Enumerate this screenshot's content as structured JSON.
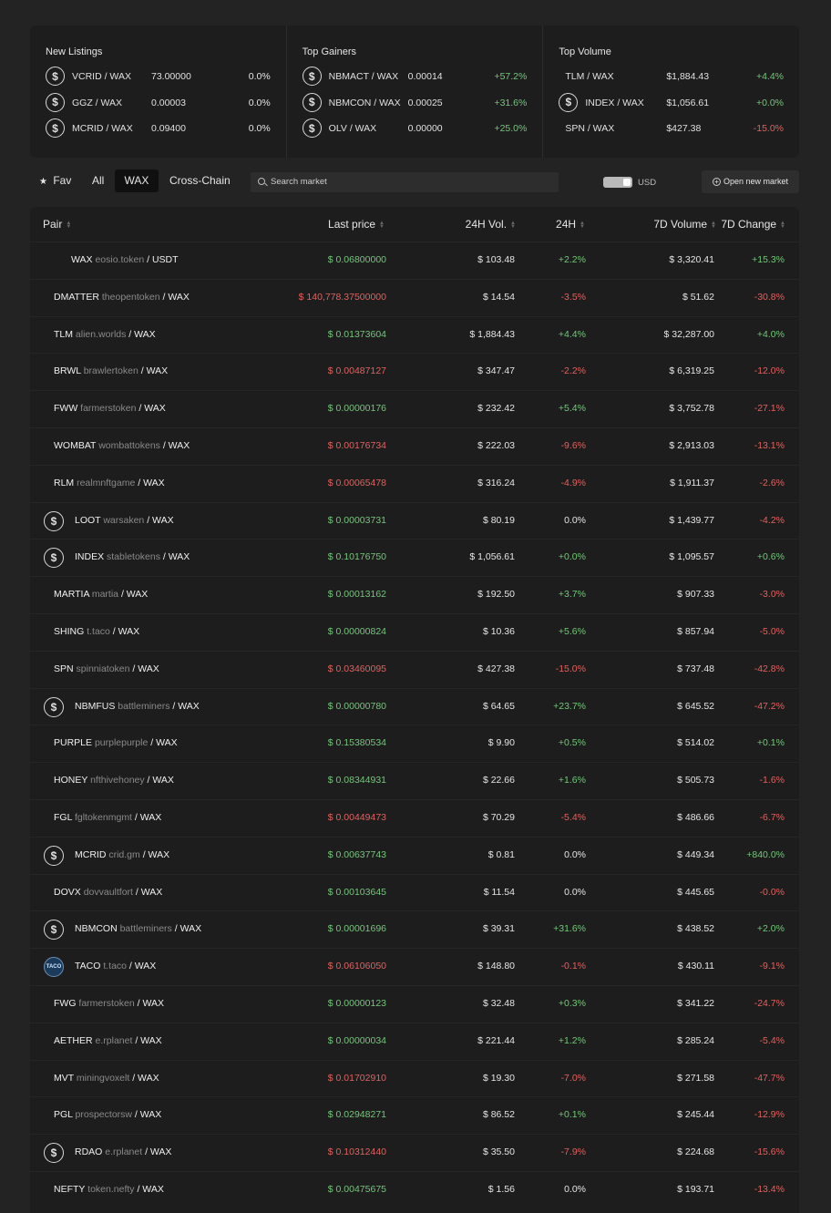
{
  "summary": {
    "new_listings": {
      "title": "New Listings",
      "rows": [
        {
          "icon": "dollar-coin-icon",
          "pair": "VCRID / WAX",
          "value": "73.00000",
          "change": "0.0%",
          "dir": "neu"
        },
        {
          "icon": "dollar-coin-icon",
          "pair": "GGZ / WAX",
          "value": "0.00003",
          "change": "0.0%",
          "dir": "neu"
        },
        {
          "icon": "dollar-coin-icon",
          "pair": "MCRID / WAX",
          "value": "0.09400",
          "change": "0.0%",
          "dir": "neu"
        }
      ]
    },
    "top_gainers": {
      "title": "Top Gainers",
      "rows": [
        {
          "icon": "dollar-coin-icon",
          "pair": "NBMACT / WAX",
          "value": "0.00014",
          "change": "+57.2%",
          "dir": "pos"
        },
        {
          "icon": "dollar-coin-icon",
          "pair": "NBMCON / WAX",
          "value": "0.00025",
          "change": "+31.6%",
          "dir": "pos"
        },
        {
          "icon": "dollar-coin-icon",
          "pair": "OLV / WAX",
          "value": "0.00000",
          "change": "+25.0%",
          "dir": "pos"
        }
      ]
    },
    "top_volume": {
      "title": "Top Volume",
      "rows": [
        {
          "icon": "",
          "pair": "TLM / WAX",
          "value": "$1,884.43",
          "change": "+4.4%",
          "dir": "pos"
        },
        {
          "icon": "dollar-coin-icon",
          "pair": "INDEX / WAX",
          "value": "$1,056.61",
          "change": "+0.0%",
          "dir": "pos"
        },
        {
          "icon": "",
          "pair": "SPN / WAX",
          "value": "$427.38",
          "change": "-15.0%",
          "dir": "neg"
        }
      ]
    }
  },
  "toolbar": {
    "fav_label": "Fav",
    "all_label": "All",
    "wax_label": "WAX",
    "cross_chain_label": "Cross-Chain",
    "search_placeholder": "Search market",
    "currency_label": "USD",
    "open_market_label": "Open new market"
  },
  "table": {
    "headers": {
      "pair": "Pair",
      "last_price": "Last price",
      "vol_24h": "24H Vol.",
      "change_24h": "24H",
      "vol_7d": "7D Volume",
      "change_7d": "7D Change"
    },
    "rows": [
      {
        "icon": "",
        "symbol": "WAX",
        "contract": "eosio.token",
        "quote": "USDT",
        "price": "$ 0.06800000",
        "price_dir": "pos",
        "vol24": "$ 103.48",
        "ch24": "+2.2%",
        "ch24_dir": "pos",
        "vol7": "$ 3,320.41",
        "ch7": "+15.3%",
        "ch7_dir": "pos"
      },
      {
        "icon": "",
        "symbol": "DMATTER",
        "contract": "theopentoken",
        "quote": "WAX",
        "price": "$ 140,778.37500000",
        "price_dir": "neg",
        "vol24": "$ 14.54",
        "ch24": "-3.5%",
        "ch24_dir": "neg",
        "vol7": "$ 51.62",
        "ch7": "-30.8%",
        "ch7_dir": "neg"
      },
      {
        "icon": "",
        "symbol": "TLM",
        "contract": "alien.worlds",
        "quote": "WAX",
        "price": "$ 0.01373604",
        "price_dir": "pos",
        "vol24": "$ 1,884.43",
        "ch24": "+4.4%",
        "ch24_dir": "pos",
        "vol7": "$ 32,287.00",
        "ch7": "+4.0%",
        "ch7_dir": "pos"
      },
      {
        "icon": "",
        "symbol": "BRWL",
        "contract": "brawlertoken",
        "quote": "WAX",
        "price": "$ 0.00487127",
        "price_dir": "neg",
        "vol24": "$ 347.47",
        "ch24": "-2.2%",
        "ch24_dir": "neg",
        "vol7": "$ 6,319.25",
        "ch7": "-12.0%",
        "ch7_dir": "neg"
      },
      {
        "icon": "",
        "symbol": "FWW",
        "contract": "farmerstoken",
        "quote": "WAX",
        "price": "$ 0.00000176",
        "price_dir": "pos",
        "vol24": "$ 232.42",
        "ch24": "+5.4%",
        "ch24_dir": "pos",
        "vol7": "$ 3,752.78",
        "ch7": "-27.1%",
        "ch7_dir": "neg"
      },
      {
        "icon": "",
        "symbol": "WOMBAT",
        "contract": "wombattokens",
        "quote": "WAX",
        "price": "$ 0.00176734",
        "price_dir": "neg",
        "vol24": "$ 222.03",
        "ch24": "-9.6%",
        "ch24_dir": "neg",
        "vol7": "$ 2,913.03",
        "ch7": "-13.1%",
        "ch7_dir": "neg"
      },
      {
        "icon": "",
        "symbol": "RLM",
        "contract": "realmnftgame",
        "quote": "WAX",
        "price": "$ 0.00065478",
        "price_dir": "neg",
        "vol24": "$ 316.24",
        "ch24": "-4.9%",
        "ch24_dir": "neg",
        "vol7": "$ 1,911.37",
        "ch7": "-2.6%",
        "ch7_dir": "neg"
      },
      {
        "icon": "dollar-coin-icon",
        "symbol": "LOOT",
        "contract": "warsaken",
        "quote": "WAX",
        "price": "$ 0.00003731",
        "price_dir": "pos",
        "vol24": "$ 80.19",
        "ch24": "0.0%",
        "ch24_dir": "neu",
        "vol7": "$ 1,439.77",
        "ch7": "-4.2%",
        "ch7_dir": "neg"
      },
      {
        "icon": "dollar-coin-icon",
        "symbol": "INDEX",
        "contract": "stabletokens",
        "quote": "WAX",
        "price": "$ 0.10176750",
        "price_dir": "pos",
        "vol24": "$ 1,056.61",
        "ch24": "+0.0%",
        "ch24_dir": "pos",
        "vol7": "$ 1,095.57",
        "ch7": "+0.6%",
        "ch7_dir": "pos"
      },
      {
        "icon": "",
        "symbol": "MARTIA",
        "contract": "martia",
        "quote": "WAX",
        "price": "$ 0.00013162",
        "price_dir": "pos",
        "vol24": "$ 192.50",
        "ch24": "+3.7%",
        "ch24_dir": "pos",
        "vol7": "$ 907.33",
        "ch7": "-3.0%",
        "ch7_dir": "neg"
      },
      {
        "icon": "",
        "symbol": "SHING",
        "contract": "t.taco",
        "quote": "WAX",
        "price": "$ 0.00000824",
        "price_dir": "pos",
        "vol24": "$ 10.36",
        "ch24": "+5.6%",
        "ch24_dir": "pos",
        "vol7": "$ 857.94",
        "ch7": "-5.0%",
        "ch7_dir": "neg"
      },
      {
        "icon": "",
        "symbol": "SPN",
        "contract": "spinniatoken",
        "quote": "WAX",
        "price": "$ 0.03460095",
        "price_dir": "neg",
        "vol24": "$ 427.38",
        "ch24": "-15.0%",
        "ch24_dir": "neg",
        "vol7": "$ 737.48",
        "ch7": "-42.8%",
        "ch7_dir": "neg"
      },
      {
        "icon": "dollar-coin-icon",
        "symbol": "NBMFUS",
        "contract": "battleminers",
        "quote": "WAX",
        "price": "$ 0.00000780",
        "price_dir": "pos",
        "vol24": "$ 64.65",
        "ch24": "+23.7%",
        "ch24_dir": "pos",
        "vol7": "$ 645.52",
        "ch7": "-47.2%",
        "ch7_dir": "neg"
      },
      {
        "icon": "",
        "symbol": "PURPLE",
        "contract": "purplepurple",
        "quote": "WAX",
        "price": "$ 0.15380534",
        "price_dir": "pos",
        "vol24": "$ 9.90",
        "ch24": "+0.5%",
        "ch24_dir": "pos",
        "vol7": "$ 514.02",
        "ch7": "+0.1%",
        "ch7_dir": "pos"
      },
      {
        "icon": "",
        "symbol": "HONEY",
        "contract": "nfthivehoney",
        "quote": "WAX",
        "price": "$ 0.08344931",
        "price_dir": "pos",
        "vol24": "$ 22.66",
        "ch24": "+1.6%",
        "ch24_dir": "pos",
        "vol7": "$ 505.73",
        "ch7": "-1.6%",
        "ch7_dir": "neg"
      },
      {
        "icon": "",
        "symbol": "FGL",
        "contract": "fgltokenmgmt",
        "quote": "WAX",
        "price": "$ 0.00449473",
        "price_dir": "neg",
        "vol24": "$ 70.29",
        "ch24": "-5.4%",
        "ch24_dir": "neg",
        "vol7": "$ 486.66",
        "ch7": "-6.7%",
        "ch7_dir": "neg"
      },
      {
        "icon": "dollar-coin-icon",
        "symbol": "MCRID",
        "contract": "crid.gm",
        "quote": "WAX",
        "price": "$ 0.00637743",
        "price_dir": "pos",
        "vol24": "$ 0.81",
        "ch24": "0.0%",
        "ch24_dir": "neu",
        "vol7": "$ 449.34",
        "ch7": "+840.0%",
        "ch7_dir": "pos"
      },
      {
        "icon": "",
        "symbol": "DOVX",
        "contract": "dovvaultfort",
        "quote": "WAX",
        "price": "$ 0.00103645",
        "price_dir": "pos",
        "vol24": "$ 11.54",
        "ch24": "0.0%",
        "ch24_dir": "neu",
        "vol7": "$ 445.65",
        "ch7": "-0.0%",
        "ch7_dir": "neg"
      },
      {
        "icon": "dollar-coin-icon",
        "symbol": "NBMCON",
        "contract": "battleminers",
        "quote": "WAX",
        "price": "$ 0.00001696",
        "price_dir": "pos",
        "vol24": "$ 39.31",
        "ch24": "+31.6%",
        "ch24_dir": "pos",
        "vol7": "$ 438.52",
        "ch7": "+2.0%",
        "ch7_dir": "pos"
      },
      {
        "icon": "taco-logo-icon",
        "symbol": "TACO",
        "contract": "t.taco",
        "quote": "WAX",
        "price": "$ 0.06106050",
        "price_dir": "neg",
        "vol24": "$ 148.80",
        "ch24": "-0.1%",
        "ch24_dir": "neg",
        "vol7": "$ 430.11",
        "ch7": "-9.1%",
        "ch7_dir": "neg"
      },
      {
        "icon": "",
        "symbol": "FWG",
        "contract": "farmerstoken",
        "quote": "WAX",
        "price": "$ 0.00000123",
        "price_dir": "pos",
        "vol24": "$ 32.48",
        "ch24": "+0.3%",
        "ch24_dir": "pos",
        "vol7": "$ 341.22",
        "ch7": "-24.7%",
        "ch7_dir": "neg"
      },
      {
        "icon": "",
        "symbol": "AETHER",
        "contract": "e.rplanet",
        "quote": "WAX",
        "price": "$ 0.00000034",
        "price_dir": "pos",
        "vol24": "$ 221.44",
        "ch24": "+1.2%",
        "ch24_dir": "pos",
        "vol7": "$ 285.24",
        "ch7": "-5.4%",
        "ch7_dir": "neg"
      },
      {
        "icon": "",
        "symbol": "MVT",
        "contract": "miningvoxelt",
        "quote": "WAX",
        "price": "$ 0.01702910",
        "price_dir": "neg",
        "vol24": "$ 19.30",
        "ch24": "-7.0%",
        "ch24_dir": "neg",
        "vol7": "$ 271.58",
        "ch7": "-47.7%",
        "ch7_dir": "neg"
      },
      {
        "icon": "",
        "symbol": "PGL",
        "contract": "prospectorsw",
        "quote": "WAX",
        "price": "$ 0.02948271",
        "price_dir": "pos",
        "vol24": "$ 86.52",
        "ch24": "+0.1%",
        "ch24_dir": "pos",
        "vol7": "$ 245.44",
        "ch7": "-12.9%",
        "ch7_dir": "neg"
      },
      {
        "icon": "dollar-coin-icon",
        "symbol": "RDAO",
        "contract": "e.rplanet",
        "quote": "WAX",
        "price": "$ 0.10312440",
        "price_dir": "neg",
        "vol24": "$ 35.50",
        "ch24": "-7.9%",
        "ch24_dir": "neg",
        "vol7": "$ 224.68",
        "ch7": "-15.6%",
        "ch7_dir": "neg"
      },
      {
        "icon": "",
        "symbol": "NEFTY",
        "contract": "token.nefty",
        "quote": "WAX",
        "price": "$ 0.00475675",
        "price_dir": "pos",
        "vol24": "$ 1.56",
        "ch24": "0.0%",
        "ch24_dir": "neu",
        "vol7": "$ 193.71",
        "ch7": "-13.4%",
        "ch7_dir": "neg"
      }
    ]
  },
  "colors": {
    "positive": "#74c77a",
    "negative": "#e0625f",
    "background": "#232323",
    "panel": "#1d1d1d"
  }
}
